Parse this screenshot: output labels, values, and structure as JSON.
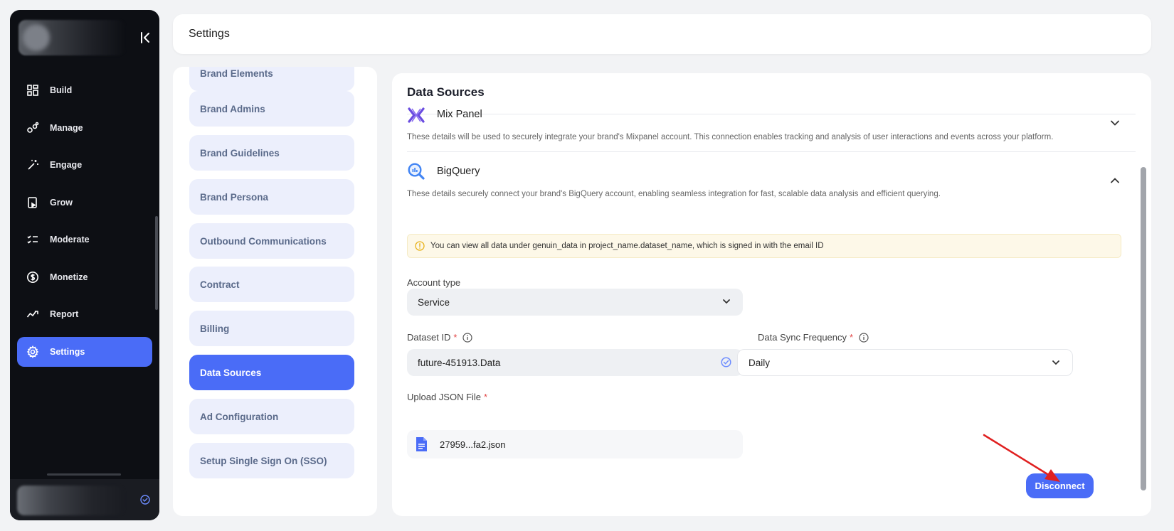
{
  "sidebar": {
    "items": [
      {
        "label": "Build",
        "icon": "grid-icon"
      },
      {
        "label": "Manage",
        "icon": "manage-icon"
      },
      {
        "label": "Engage",
        "icon": "magic-wand-icon"
      },
      {
        "label": "Grow",
        "icon": "grow-icon"
      },
      {
        "label": "Moderate",
        "icon": "checklist-icon"
      },
      {
        "label": "Monetize",
        "icon": "dollar-icon"
      },
      {
        "label": "Report",
        "icon": "trend-icon"
      },
      {
        "label": "Settings",
        "icon": "gear-icon",
        "active": true
      }
    ]
  },
  "header": {
    "title": "Settings"
  },
  "settings_nav": {
    "items": [
      {
        "label": "Brand Elements"
      },
      {
        "label": "Brand Admins"
      },
      {
        "label": "Brand Guidelines"
      },
      {
        "label": "Brand Persona"
      },
      {
        "label": "Outbound Communications"
      },
      {
        "label": "Contract"
      },
      {
        "label": "Billing"
      },
      {
        "label": "Data Sources",
        "active": true
      },
      {
        "label": "Ad Configuration"
      },
      {
        "label": "Setup Single Sign On (SSO)"
      }
    ]
  },
  "main": {
    "title": "Data Sources",
    "mixpanel": {
      "name": "Mix Panel",
      "description": "These details will be used to securely integrate your brand's Mixpanel account. This connection enables tracking and analysis of user interactions and events across your platform."
    },
    "bigquery": {
      "name": "BigQuery",
      "description": "These details securely connect your brand's BigQuery account, enabling seamless integration for fast, scalable data analysis and efficient querying.",
      "notice": "You can view all data under genuin_data in project_name.dataset_name, which is signed in with the email ID",
      "account_type": {
        "label": "Account type",
        "value": "Service"
      },
      "dataset_id": {
        "label": "Dataset ID",
        "required": "*",
        "value": "future-451913.Data"
      },
      "sync_frequency": {
        "label": "Data Sync Frequency",
        "required": "*",
        "value": "Daily"
      },
      "upload": {
        "label": "Upload JSON File",
        "required": "*",
        "file_name": "27959...fa2.json"
      },
      "disconnect_label": "Disconnect"
    }
  },
  "colors": {
    "accent": "#4a6cf7",
    "sidebar_bg": "#0d0f14",
    "notice_bg": "#fdf8e8",
    "annotation_arrow": "#e02020"
  }
}
